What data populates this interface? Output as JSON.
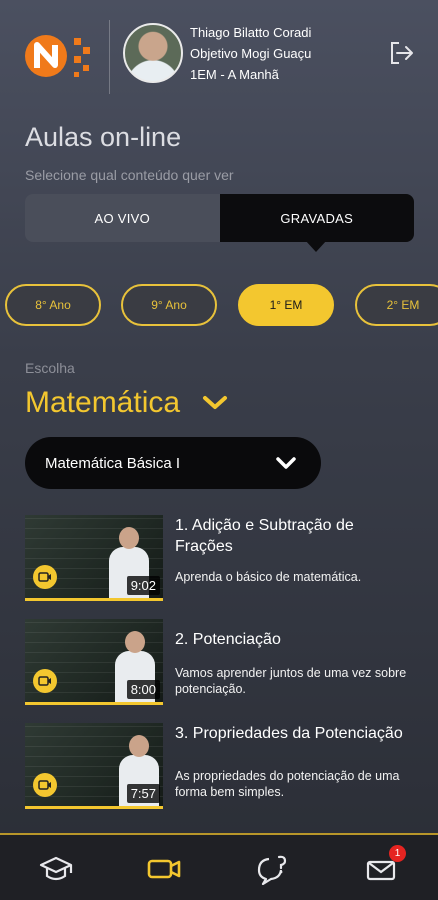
{
  "user": {
    "name": "Thiago Bilatto Coradi",
    "school": "Objetivo Mogi Guaçu",
    "class": "1EM - A Manhã"
  },
  "page": {
    "title": "Aulas on-line",
    "subtitle": "Selecione qual conteúdo quer ver"
  },
  "segmented": {
    "live_label": "AO VIVO",
    "recorded_label": "GRAVADAS",
    "selected": "GRAVADAS"
  },
  "grades": [
    {
      "label": "8° Ano",
      "active": false
    },
    {
      "label": "9° Ano",
      "active": false
    },
    {
      "label": "1° EM",
      "active": true
    },
    {
      "label": "2° EM",
      "active": false
    }
  ],
  "subject": {
    "prompt": "Escolha",
    "selected": "Matemática",
    "module": "Matemática Básica I"
  },
  "lessons": [
    {
      "title": "1. Adição e Subtração de Frações",
      "description": "Aprenda o básico de matemática.",
      "duration": "9:02"
    },
    {
      "title": "2. Potenciação",
      "description": "Vamos aprender juntos de uma vez sobre potenciação.",
      "duration": "8:00"
    },
    {
      "title": "3. Propriedades da Potenciação",
      "description": "As propriedades do potenciação de uma forma bem simples.",
      "duration": "7:57"
    }
  ],
  "tabbar": {
    "messages_badge": "1",
    "active_tab": "video-icon"
  },
  "colors": {
    "accent": "#f3c72f",
    "brand_orange": "#f07a1a",
    "badge": "#e52421",
    "dark": "#0c0c0e"
  }
}
